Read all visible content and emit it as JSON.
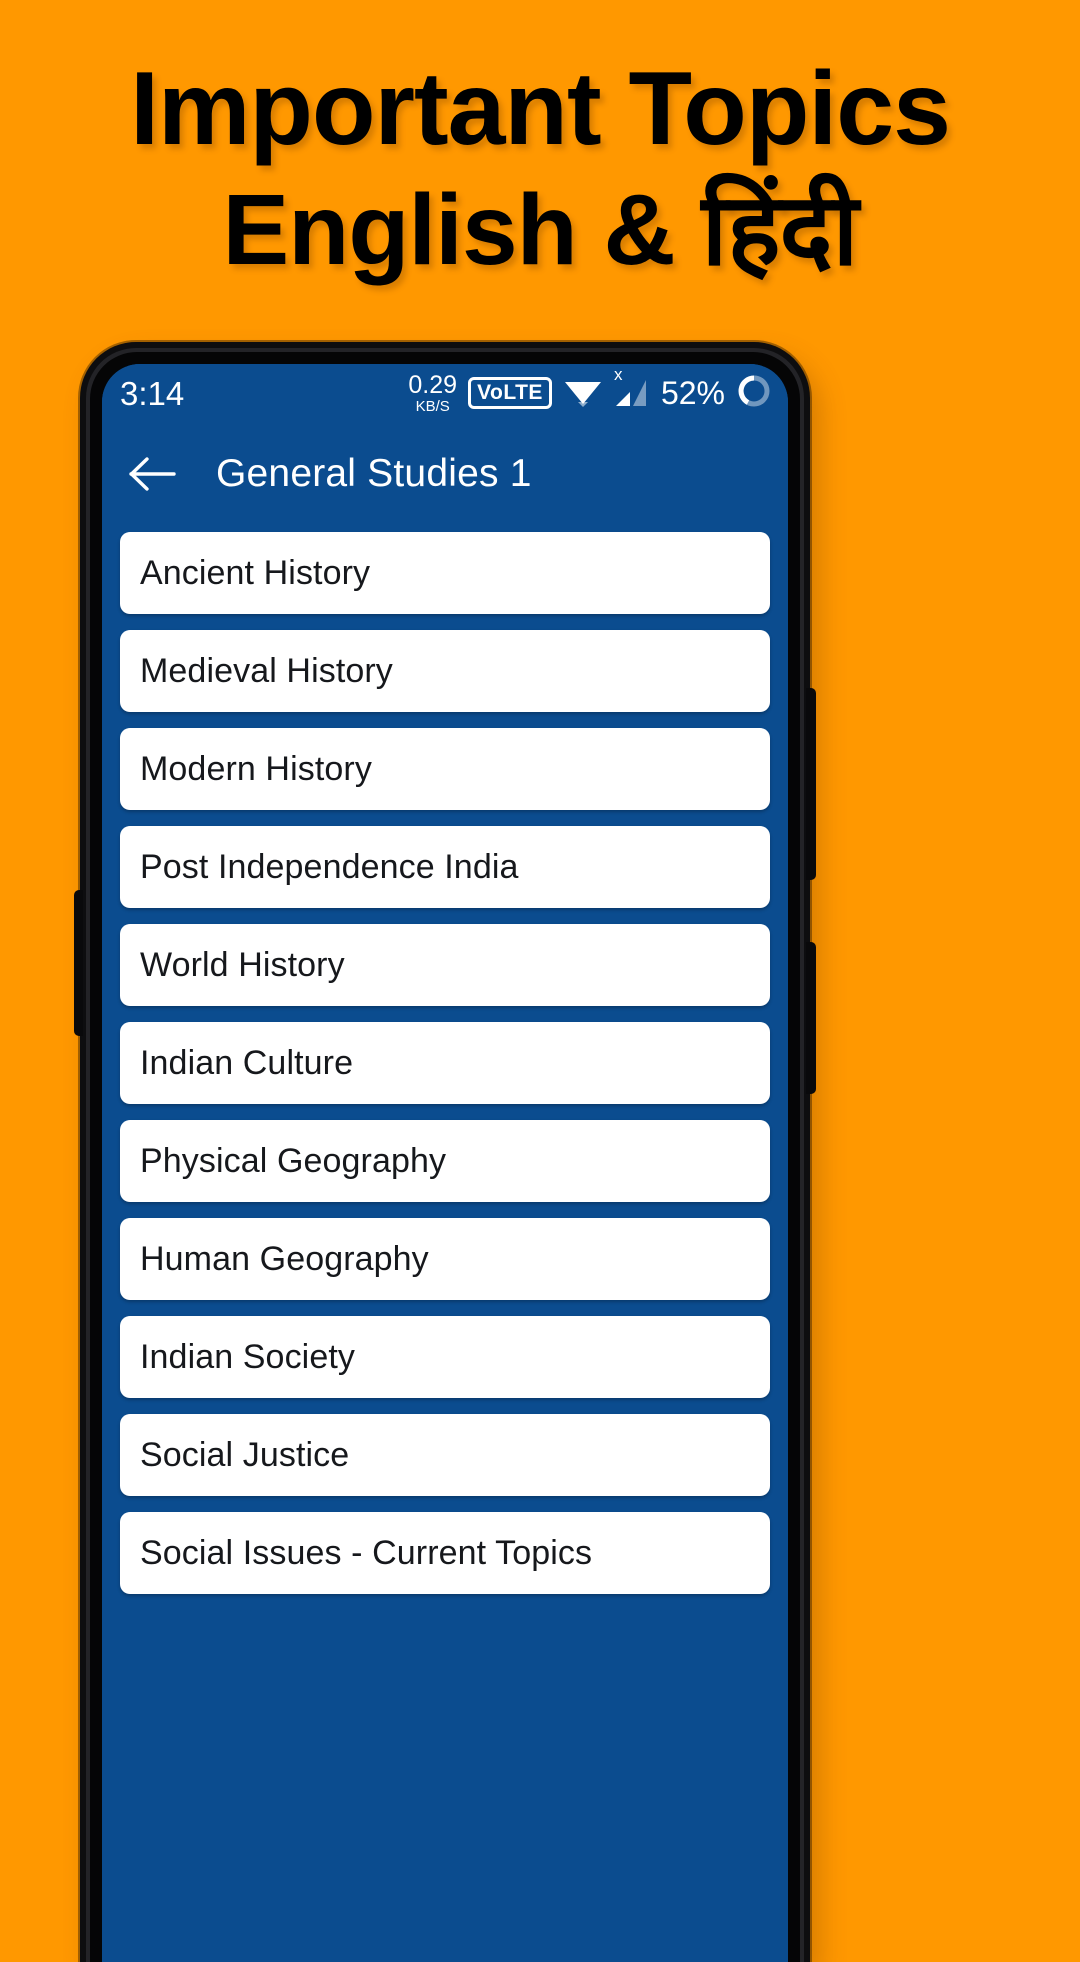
{
  "promo": {
    "line1": "Important Topics",
    "line2": "English & हिंदी"
  },
  "colors": {
    "background_orange": "#FF9800",
    "app_blue": "#0b4c8f",
    "card_white": "#FFFFFF",
    "frame_black": "#0d0d0f",
    "text_dark": "#16181C"
  },
  "status_bar": {
    "clock": "3:14",
    "net_speed_value": "0.29",
    "net_speed_unit": "KB/S",
    "volte_label": "VoLTE",
    "wifi_icon": "wifi-icon",
    "signal_icon": "cellular-signal-icon",
    "signal_badge": "x",
    "battery_percent": "52%",
    "battery_icon": "battery-circle-icon"
  },
  "app_bar": {
    "back_icon": "back-arrow-icon",
    "title": "General Studies 1"
  },
  "topics": [
    {
      "label": "Ancient History"
    },
    {
      "label": "Medieval History"
    },
    {
      "label": "Modern History"
    },
    {
      "label": "Post Independence India"
    },
    {
      "label": "World History"
    },
    {
      "label": "Indian Culture"
    },
    {
      "label": "Physical Geography"
    },
    {
      "label": "Human Geography"
    },
    {
      "label": "Indian Society"
    },
    {
      "label": "Social Justice"
    },
    {
      "label": "Social Issues - Current Topics"
    }
  ]
}
